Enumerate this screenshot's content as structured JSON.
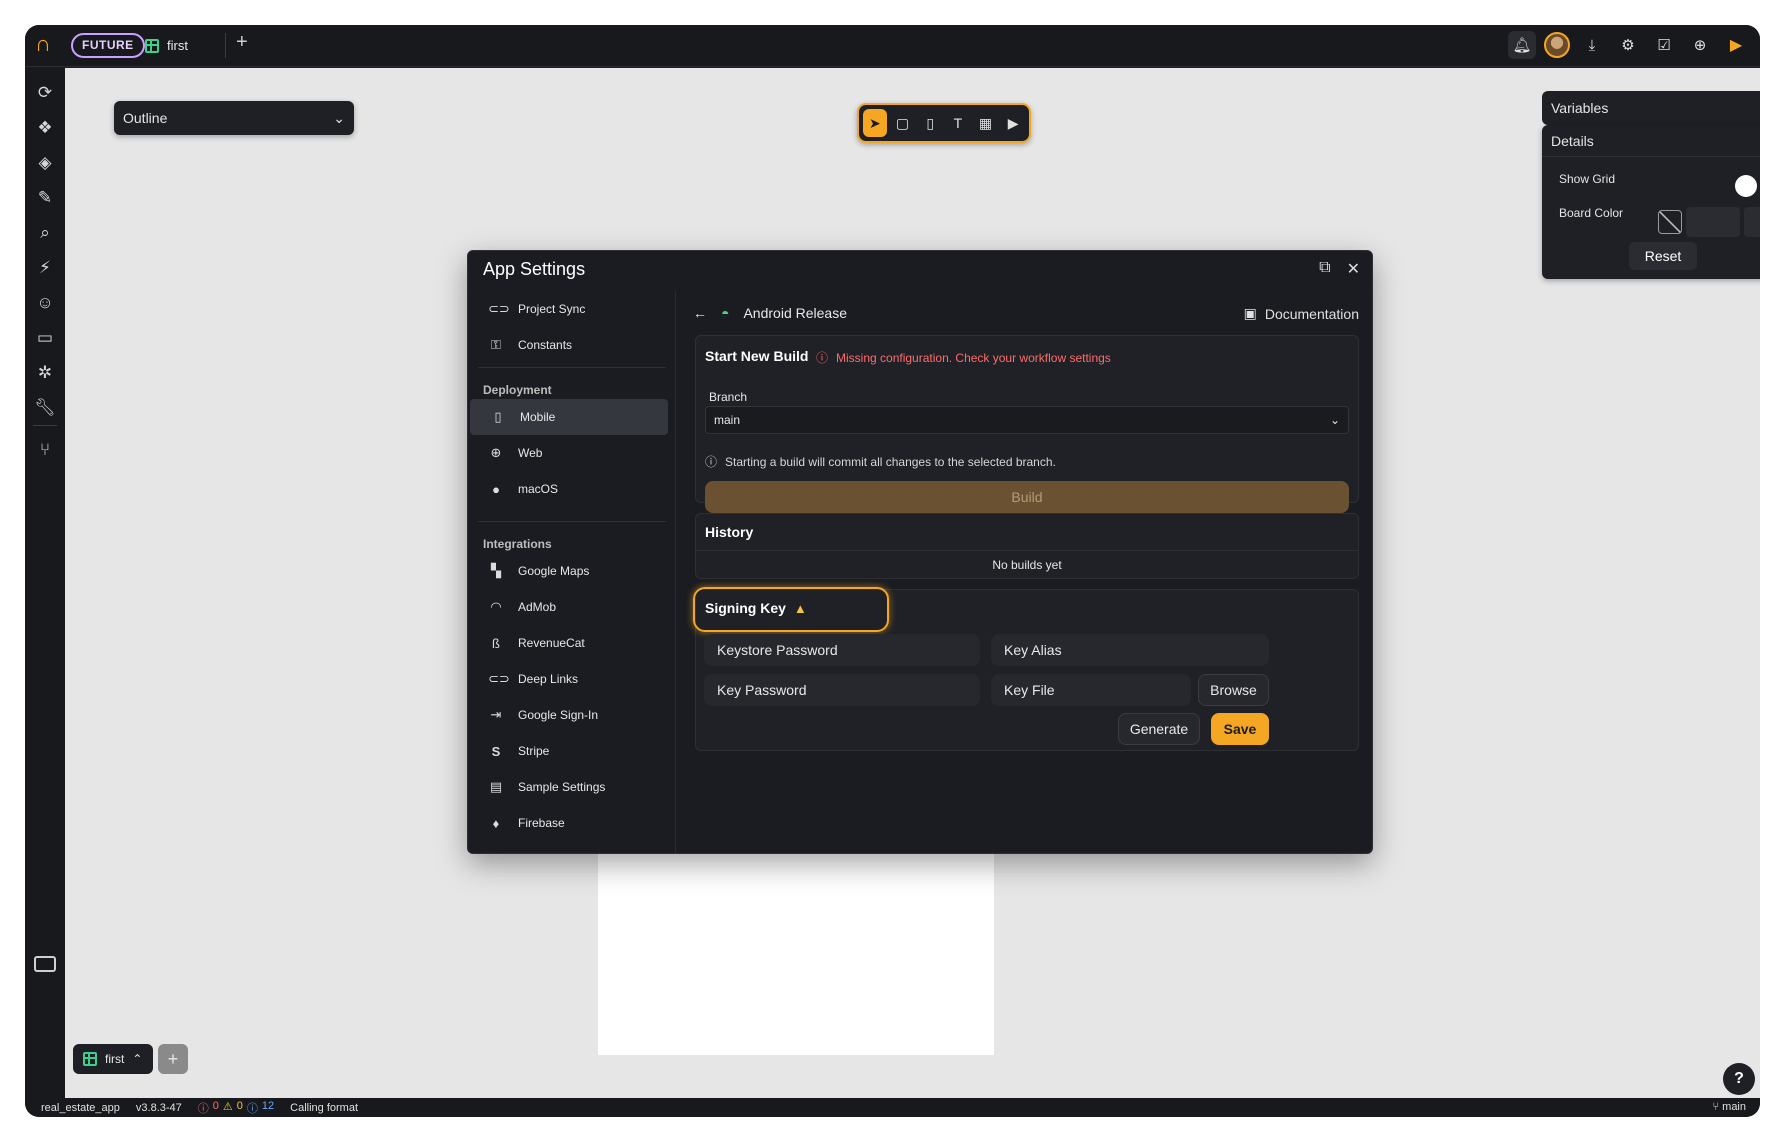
{
  "topbar": {
    "badge": "FUTURE",
    "tab_label": "first",
    "add_tab": "+",
    "icons": [
      "bell-icon",
      "avatar",
      "download-icon",
      "gear-icon",
      "check-icon",
      "globe-icon",
      "play-icon"
    ]
  },
  "canvas": {
    "outline_label": "Outline",
    "variables_label": "Variables",
    "details": {
      "title": "Details",
      "show_grid_label": "Show Grid",
      "show_grid_on": true,
      "board_color_label": "Board Color",
      "reset_label": "Reset"
    }
  },
  "toolbar": {
    "tools": [
      "pointer",
      "frame",
      "device",
      "text",
      "components",
      "play"
    ]
  },
  "modal": {
    "title": "App Settings",
    "sidebar": {
      "top_items": [
        {
          "label": "Project Sync",
          "icon": "link-icon"
        },
        {
          "label": "Constants",
          "icon": "key-icon"
        }
      ],
      "deployment_title": "Deployment",
      "deployment_items": [
        {
          "label": "Mobile",
          "icon": "mobile-icon",
          "active": true
        },
        {
          "label": "Web",
          "icon": "globe-icon"
        },
        {
          "label": "macOS",
          "icon": "apple-icon"
        }
      ],
      "integrations_title": "Integrations",
      "integration_items": [
        {
          "label": "Google Maps",
          "icon": "map-icon"
        },
        {
          "label": "AdMob",
          "icon": "admob-icon"
        },
        {
          "label": "RevenueCat",
          "icon": "revenuecat-icon"
        },
        {
          "label": "Deep Links",
          "icon": "link-icon"
        },
        {
          "label": "Google Sign-In",
          "icon": "sign-in-icon"
        },
        {
          "label": "Stripe",
          "icon": "stripe-icon"
        },
        {
          "label": "Sample Settings",
          "icon": "settings-icon"
        },
        {
          "label": "Firebase",
          "icon": "firebase-icon"
        }
      ]
    },
    "main": {
      "header_title": "Android Release",
      "documentation_label": "Documentation",
      "build_card": {
        "title": "Start New Build",
        "warning": "Missing configuration. Check your workflow settings",
        "branch_label": "Branch",
        "branch_value": "main",
        "info_text": "Starting a build will commit all changes to the selected branch.",
        "build_label": "Build"
      },
      "history_card": {
        "title": "History",
        "empty_text": "No builds yet"
      },
      "signing_card": {
        "title": "Signing Key",
        "keystore_password": "Keystore Password",
        "key_alias": "Key Alias",
        "key_password": "Key Password",
        "key_file": "Key File",
        "browse_label": "Browse",
        "generate_label": "Generate",
        "save_label": "Save"
      }
    }
  },
  "bottom": {
    "tab_label": "first",
    "add_label": "+",
    "help_label": "?"
  },
  "statusbar": {
    "project": "real_estate_app",
    "version": "v3.8.3-47",
    "errors": "0",
    "warnings": "0",
    "infos": "12",
    "status_text": "Calling format",
    "branch": "main"
  },
  "colors": {
    "accent": "#f5a623",
    "error": "#ff6b6b",
    "android": "#3ddc84",
    "badge_border": "#c9a0ff"
  }
}
